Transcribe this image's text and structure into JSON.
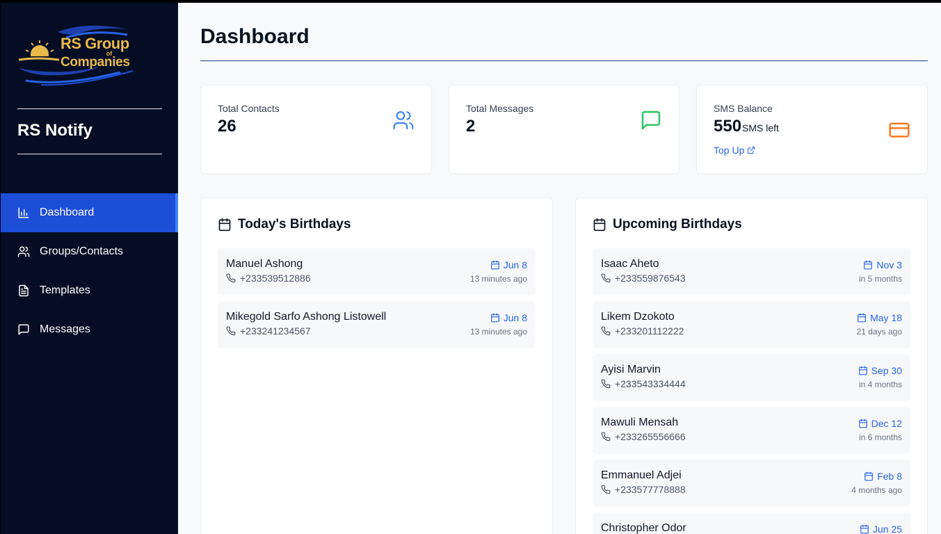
{
  "brand": {
    "logo_line1": "RS Group",
    "logo_line2": "of",
    "logo_line3": "Companies",
    "app_name": "RS Notify"
  },
  "nav": {
    "items": [
      {
        "label": "Dashboard",
        "icon": "bar-chart-icon",
        "active": true
      },
      {
        "label": "Groups/Contacts",
        "icon": "users-icon",
        "active": false
      },
      {
        "label": "Templates",
        "icon": "file-text-icon",
        "active": false
      },
      {
        "label": "Messages",
        "icon": "message-square-icon",
        "active": false
      }
    ]
  },
  "page": {
    "title": "Dashboard"
  },
  "stats": {
    "contacts": {
      "label": "Total Contacts",
      "value": "26",
      "icon": "users-icon",
      "color": "#3b82f6"
    },
    "messages": {
      "label": "Total Messages",
      "value": "2",
      "icon": "message-square-icon",
      "color": "#22c55e"
    },
    "sms": {
      "label": "SMS Balance",
      "value": "550",
      "suffix": "SMS left",
      "topup": "Top Up",
      "icon": "credit-card-icon",
      "color": "#f97316"
    }
  },
  "today": {
    "title": "Today's Birthdays",
    "items": [
      {
        "name": "Manuel Ashong",
        "phone": "+233539512886",
        "date": "Jun 8",
        "relative": "13 minutes ago"
      },
      {
        "name": "Mikegold Sarfo Ashong Listowell",
        "phone": "+233241234567",
        "date": "Jun 8",
        "relative": "13 minutes ago"
      }
    ]
  },
  "upcoming": {
    "title": "Upcoming Birthdays",
    "items": [
      {
        "name": "Isaac Aheto",
        "phone": "+233559876543",
        "date": "Nov 3",
        "relative": "in 5 months"
      },
      {
        "name": "Likem Dzokoto",
        "phone": "+233201112222",
        "date": "May 18",
        "relative": "21 days ago"
      },
      {
        "name": "Ayisi Marvin",
        "phone": "+233543334444",
        "date": "Sep 30",
        "relative": "in 4 months"
      },
      {
        "name": "Mawuli Mensah",
        "phone": "+233265556666",
        "date": "Dec 12",
        "relative": "in 6 months"
      },
      {
        "name": "Emmanuel Adjei",
        "phone": "+233577778888",
        "date": "Feb 8",
        "relative": "4 months ago"
      },
      {
        "name": "Christopher Odor",
        "phone": "",
        "date": "Jun 25",
        "relative": ""
      }
    ]
  },
  "colors": {
    "sidebar_bg": "#050d24",
    "active_nav": "#1d4ed8",
    "accent": "#2563eb"
  }
}
